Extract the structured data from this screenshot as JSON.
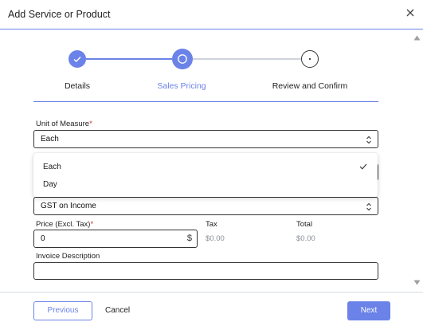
{
  "dialog": {
    "title": "Add Service or Product",
    "close_icon": "close-icon"
  },
  "stepper": {
    "steps": [
      {
        "label": "Details",
        "state": "completed"
      },
      {
        "label": "Sales Pricing",
        "state": "current"
      },
      {
        "label": "Review and Confirm",
        "state": "pending"
      }
    ]
  },
  "form": {
    "unit_of_measure": {
      "label": "Unit of Measure",
      "required_mark": "*",
      "value": "Each",
      "options": [
        {
          "label": "Each",
          "selected": true
        },
        {
          "label": "Day",
          "selected": false
        }
      ]
    },
    "tax_code": {
      "value": "GST on Income"
    },
    "price": {
      "label": "Price (Excl. Tax)",
      "required_mark": "*",
      "value": "0",
      "currency_symbol": "$"
    },
    "tax": {
      "label": "Tax",
      "value": "$0.00"
    },
    "total": {
      "label": "Total",
      "value": "$0.00"
    },
    "invoice_description": {
      "label": "Invoice Description",
      "value": ""
    }
  },
  "footer": {
    "previous_label": "Previous",
    "cancel_label": "Cancel",
    "next_label": "Next"
  },
  "colors": {
    "accent": "#6b82e8",
    "border": "#333333",
    "required": "#d32f2f",
    "muted": "#8a8f98"
  }
}
